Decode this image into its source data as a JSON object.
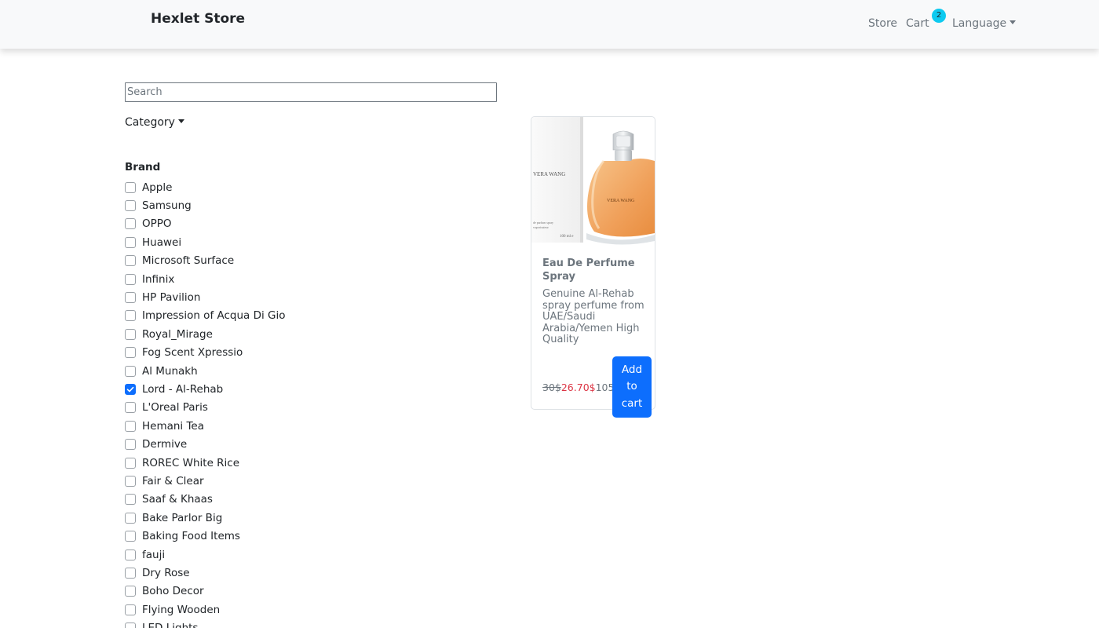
{
  "navbar": {
    "brand": "Hexlet Store",
    "links": {
      "store": "Store",
      "cart": "Cart",
      "cart_count": "2",
      "language": "Language"
    }
  },
  "search": {
    "placeholder": "Search",
    "value": ""
  },
  "filters": {
    "category_label": "Category",
    "brand_heading": "Brand",
    "brands": [
      {
        "label": "Apple",
        "checked": false
      },
      {
        "label": "Samsung",
        "checked": false
      },
      {
        "label": "OPPO",
        "checked": false
      },
      {
        "label": "Huawei",
        "checked": false
      },
      {
        "label": "Microsoft Surface",
        "checked": false
      },
      {
        "label": "Infinix",
        "checked": false
      },
      {
        "label": "HP Pavilion",
        "checked": false
      },
      {
        "label": "Impression of Acqua Di Gio",
        "checked": false
      },
      {
        "label": "Royal_Mirage",
        "checked": false
      },
      {
        "label": "Fog Scent Xpressio",
        "checked": false
      },
      {
        "label": "Al Munakh",
        "checked": false
      },
      {
        "label": "Lord - Al-Rehab",
        "checked": true
      },
      {
        "label": "L'Oreal Paris",
        "checked": false
      },
      {
        "label": "Hemani Tea",
        "checked": false
      },
      {
        "label": "Dermive",
        "checked": false
      },
      {
        "label": "ROREC White Rice",
        "checked": false
      },
      {
        "label": "Fair & Clear",
        "checked": false
      },
      {
        "label": "Saaf & Khaas",
        "checked": false
      },
      {
        "label": "Bake Parlor Big",
        "checked": false
      },
      {
        "label": "Baking Food Items",
        "checked": false
      },
      {
        "label": "fauji",
        "checked": false
      },
      {
        "label": "Dry Rose",
        "checked": false
      },
      {
        "label": "Boho Decor",
        "checked": false
      },
      {
        "label": "Flying Wooden",
        "checked": false
      },
      {
        "label": "LED Lights",
        "checked": false
      }
    ]
  },
  "products": [
    {
      "title": "Eau De Perfume Spray",
      "description": "Genuine Al-Rehab spray perfume from UAE/Saudi Arabia/Yemen High Quality",
      "price_old": "30$",
      "price_new": "26.70$",
      "price_extra": "105",
      "add_button": "Add to cart",
      "image_text": {
        "box_brand": "VERA WANG",
        "bottle_brand": "VERA WANG",
        "box_size": "100 ml e",
        "box_caption_1": "de parfum spray",
        "box_caption_2": "vaporisateur"
      }
    }
  ],
  "colors": {
    "primary": "#0d6efd",
    "sale_price": "#dc3545",
    "badge": "#0dcaf0",
    "muted": "#6c757d",
    "navbar_bg": "#f8f9fa"
  },
  "icons": {
    "checkbox_check": "check-icon",
    "dropdown": "caret-down-icon"
  }
}
